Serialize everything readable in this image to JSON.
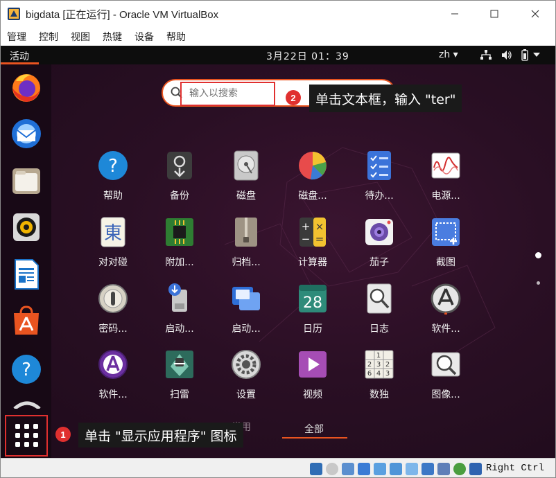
{
  "window": {
    "title": "bigdata [正在运行] - Oracle VM VirtualBox",
    "menu": [
      "管理",
      "控制",
      "视图",
      "热键",
      "设备",
      "帮助"
    ]
  },
  "topbar": {
    "activities": "活动",
    "clock": "3月22日  01：39",
    "lang": "zh ▾"
  },
  "search": {
    "placeholder": "输入以搜索"
  },
  "annotations": {
    "step1_num": "1",
    "step1_text": "单击 \"显示应用程序\" 图标",
    "step2_num": "2",
    "step2_text": "单击文本框，输入 \"ter\""
  },
  "apps": [
    {
      "label": "帮助",
      "icon": "help-icon"
    },
    {
      "label": "备份",
      "icon": "backup-icon"
    },
    {
      "label": "磁盘",
      "icon": "disks-icon"
    },
    {
      "label": "磁盘...",
      "icon": "disk-usage-icon"
    },
    {
      "label": "待办...",
      "icon": "todo-icon"
    },
    {
      "label": "电源...",
      "icon": "power-statistics-icon"
    },
    {
      "label": "对对碰",
      "icon": "mahjongg-icon"
    },
    {
      "label": "附加...",
      "icon": "chip-icon"
    },
    {
      "label": "归档...",
      "icon": "archive-icon"
    },
    {
      "label": "计算器",
      "icon": "calculator-icon"
    },
    {
      "label": "茄子",
      "icon": "cheese-camera-icon"
    },
    {
      "label": "截图",
      "icon": "screenshot-icon"
    },
    {
      "label": "密码...",
      "icon": "passwords-icon"
    },
    {
      "label": "启动...",
      "icon": "usb-creator-icon"
    },
    {
      "label": "启动...",
      "icon": "startup-apps-icon"
    },
    {
      "label": "日历",
      "icon": "calendar-icon"
    },
    {
      "label": "日志",
      "icon": "logs-icon"
    },
    {
      "label": "软件...",
      "icon": "software-updater-icon"
    },
    {
      "label": "软件...",
      "icon": "software-properties-icon"
    },
    {
      "label": "扫雷",
      "icon": "mines-icon"
    },
    {
      "label": "设置",
      "icon": "settings-icon"
    },
    {
      "label": "视频",
      "icon": "videos-icon"
    },
    {
      "label": "数独",
      "icon": "sudoku-icon"
    },
    {
      "label": "图像...",
      "icon": "image-viewer-icon"
    }
  ],
  "calendar_day": "28",
  "sudoku_digits": [
    "1",
    "2",
    "3",
    "2",
    "6",
    "4",
    "3"
  ],
  "tabs": {
    "frequent": "常用",
    "all": "全部"
  },
  "dock": [
    "firefox-icon",
    "thunderbird-icon",
    "files-icon",
    "rhythmbox-icon",
    "libreoffice-writer-icon",
    "ubuntu-software-icon",
    "help-icon",
    "show-applications-icon"
  ],
  "statusbar": {
    "hostkey": "Right Ctrl"
  },
  "colors": {
    "accent": "#e95420",
    "annotation_red": "#e0302f",
    "background": "#2a0f24"
  }
}
